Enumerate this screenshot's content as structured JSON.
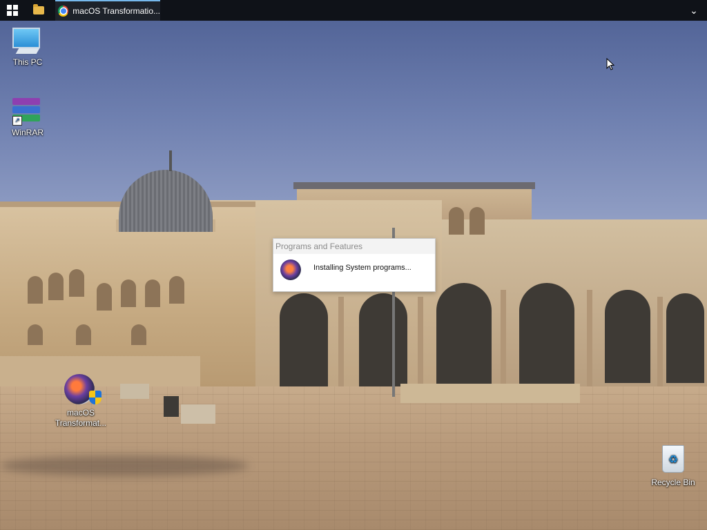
{
  "taskbar": {
    "start_icon": "windows-logo-icon",
    "explorer_icon": "file-explorer-icon",
    "chrome_task": {
      "icon": "chrome-icon",
      "label": "macOS Transformatio..."
    },
    "overflow_icon": "chevron-down-icon",
    "overflow_glyph": "⌄"
  },
  "desktop": {
    "icons": [
      {
        "label": "This PC",
        "icon": "this-pc-icon"
      },
      {
        "label": "WinRAR",
        "icon": "winrar-icon",
        "shortcut": true
      },
      {
        "label": "macOS Transformat...",
        "icon": "macos-transformation-icon"
      },
      {
        "label": "Recycle Bin",
        "icon": "recycle-bin-icon"
      }
    ]
  },
  "installer": {
    "title": "Programs and Features",
    "message": "Installing System programs...",
    "icon": "macos-transformation-icon"
  },
  "colors": {
    "taskbar": "#0f1218",
    "active_task_accent": "#76b9ed"
  }
}
